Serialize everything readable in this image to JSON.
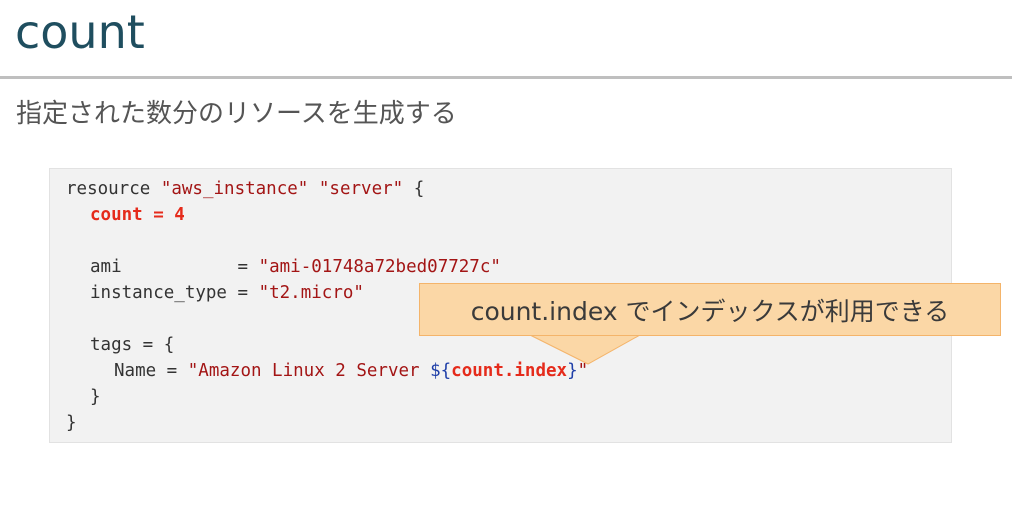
{
  "slide": {
    "title": "count",
    "subtitle": "指定された数分のリソースを生成する"
  },
  "code": {
    "line1_kw": "resource ",
    "line1_s1": "\"aws_instance\"",
    "line1_sp": " ",
    "line1_s2": "\"server\"",
    "line1_end": " {",
    "line2": "count = 4",
    "line4_key": "ami           = ",
    "line4_val": "\"ami-01748a72bed07727c\"",
    "line5_key": "instance_type = ",
    "line5_val": "\"t2.micro\"",
    "line7": "tags = {",
    "line8_key": "Name = ",
    "line8_pre": "\"Amazon Linux 2 Server ",
    "line8_open": "${",
    "line8_hl": "count.index",
    "line8_close": "}",
    "line8_post": "\"",
    "line9": "}",
    "line10": "}"
  },
  "callout": {
    "text": "count.index でインデックスが利用できる"
  },
  "colors": {
    "title": "#1f4e5f",
    "string": "#a31515",
    "highlight": "#e52b1b",
    "interpolation": "#1f3fa8",
    "callout_bg": "#fbd7a6",
    "callout_border": "#f4b46a"
  }
}
